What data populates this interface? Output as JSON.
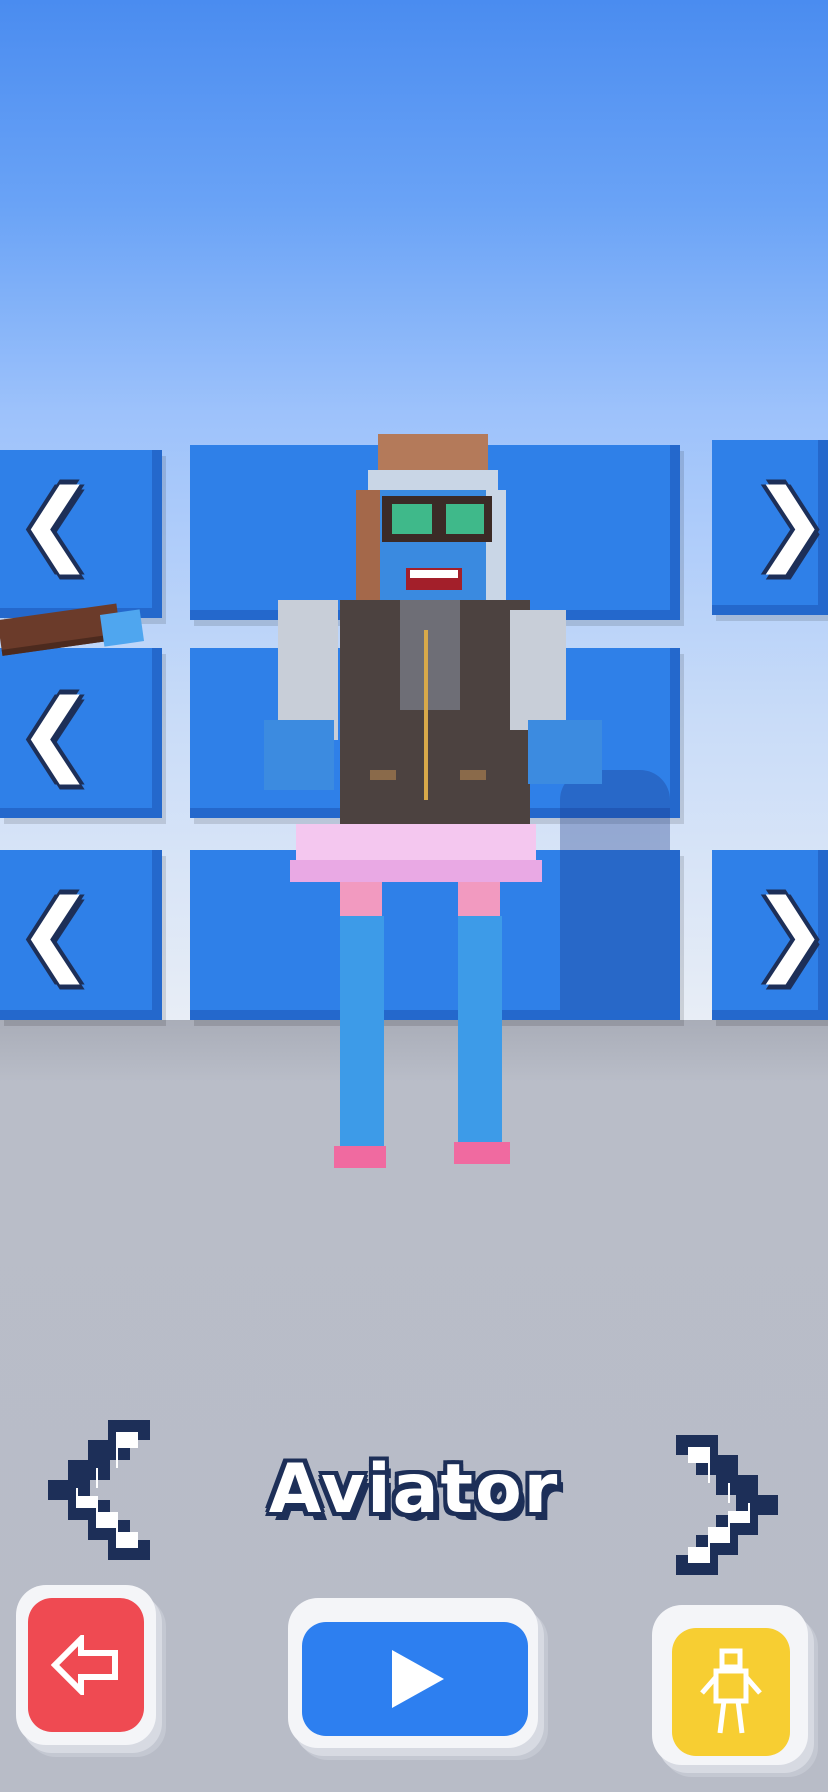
{
  "skin": {
    "name": "Aviator"
  },
  "controls": {
    "prev_icon": "chevron-left-icon",
    "next_icon": "chevron-right-icon",
    "back_icon": "arrow-left-icon",
    "play_icon": "play-icon",
    "skin_icon": "character-icon"
  },
  "colors": {
    "panel_blue": "#2f80e8",
    "back_red": "#ef4a52",
    "play_blue": "#2d7ff0",
    "skin_yellow": "#f7ce32",
    "outline_navy": "#1d2f58"
  }
}
